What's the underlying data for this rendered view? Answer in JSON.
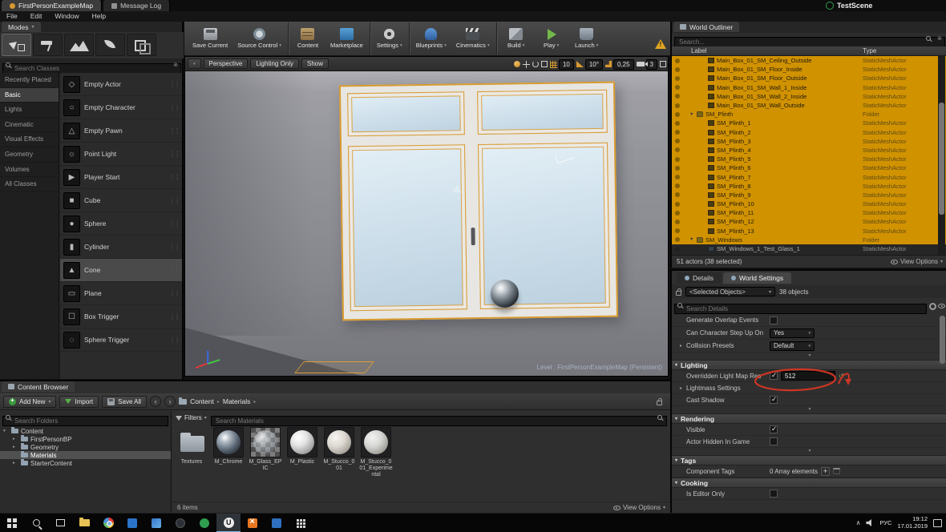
{
  "colors": {
    "selection_orange": "#D19200",
    "annotation_red": "#CC3524",
    "play_green": "#74B84C",
    "sky_blue": "#CCDEEA"
  },
  "titlebar": {
    "tabs": [
      {
        "label": "FirstPersonExampleMap"
      },
      {
        "label": "Message Log"
      }
    ],
    "scene_name": "TestScene"
  },
  "menubar": {
    "items": [
      "File",
      "Edit",
      "Window",
      "Help"
    ]
  },
  "modes": {
    "tab_label": "Modes",
    "tools": [
      {
        "name": "place-mode-icon",
        "cls": "mi-place",
        "active": true
      },
      {
        "name": "paint-mode-icon",
        "cls": "mi-paint",
        "active": false
      },
      {
        "name": "landscape-mode-icon",
        "cls": "mi-landscape",
        "active": false
      },
      {
        "name": "foliage-mode-icon",
        "cls": "mi-foliage",
        "active": false
      },
      {
        "name": "geometry-mode-icon",
        "cls": "mi-geometry",
        "active": false
      }
    ],
    "search_placeholder": "Search Classes",
    "categories": [
      {
        "label": "Recently Placed",
        "active": false
      },
      {
        "label": "Basic",
        "active": true
      },
      {
        "label": "Lights",
        "active": false
      },
      {
        "label": "Cinematic",
        "active": false
      },
      {
        "label": "Visual Effects",
        "active": false
      },
      {
        "label": "Geometry",
        "active": false
      },
      {
        "label": "Volumes",
        "active": false
      },
      {
        "label": "All Classes",
        "active": false
      }
    ],
    "actors": [
      {
        "label": "Empty Actor",
        "glyph": "◇",
        "active": false
      },
      {
        "label": "Empty Character",
        "glyph": "○",
        "active": false
      },
      {
        "label": "Empty Pawn",
        "glyph": "△",
        "active": false
      },
      {
        "label": "Point Light",
        "glyph": "☼",
        "active": false
      },
      {
        "label": "Player Start",
        "glyph": "▶",
        "active": false
      },
      {
        "label": "Cube",
        "glyph": "■",
        "active": false
      },
      {
        "label": "Sphere",
        "glyph": "●",
        "active": false
      },
      {
        "label": "Cylinder",
        "glyph": "▮",
        "active": false
      },
      {
        "label": "Cone",
        "glyph": "▲",
        "active": true
      },
      {
        "label": "Plane",
        "glyph": "▭",
        "active": false
      },
      {
        "label": "Box Trigger",
        "glyph": "☐",
        "active": false
      },
      {
        "label": "Sphere Trigger",
        "glyph": "◌",
        "active": false
      }
    ]
  },
  "toolbar": {
    "buttons": [
      {
        "label": "Save Current",
        "cls": "ic-save",
        "dropdown": false,
        "sep": false
      },
      {
        "label": "Source Control",
        "cls": "ic-sc",
        "dropdown": true,
        "sep": true
      },
      {
        "label": "Content",
        "cls": "ic-content",
        "dropdown": false,
        "sep": false
      },
      {
        "label": "Marketplace",
        "cls": "ic-market",
        "dropdown": false,
        "sep": true
      },
      {
        "label": "Settings",
        "cls": "ic-settings",
        "dropdown": true,
        "sep": true
      },
      {
        "label": "Blueprints",
        "cls": "ic-bp",
        "dropdown": true,
        "sep": false
      },
      {
        "label": "Cinematics",
        "cls": "ic-cine",
        "dropdown": true,
        "sep": true
      },
      {
        "label": "Build",
        "cls": "ic-build",
        "dropdown": true,
        "sep": false
      },
      {
        "label": "Play",
        "cls": "ic-play",
        "dropdown": true,
        "sep": false
      },
      {
        "label": "Launch",
        "cls": "ic-launch",
        "dropdown": true,
        "sep": false
      }
    ]
  },
  "viewport": {
    "camera_mode": "Perspective",
    "view_mode": "Lighting Only",
    "show_label": "Show",
    "grid_snap_value": "10",
    "rotation_snap_value": "10°",
    "scale_snap_value": "0,25",
    "camera_speed_value": "3",
    "level_label": "Level : FirstPersonExampleMap (Persistent)"
  },
  "outliner": {
    "tab_label": "World Outliner",
    "search_placeholder": "Search...",
    "columns": [
      "Label",
      "Type"
    ],
    "rows": [
      {
        "label": "Main_Box_01_SM_Ceiling_Outside",
        "type": "StaticMeshActor",
        "exp": "",
        "icon": "mesh",
        "ind": "i2",
        "sel": true
      },
      {
        "label": "Main_Box_01_SM_Floor_Inside",
        "type": "StaticMeshActor",
        "exp": "",
        "icon": "mesh",
        "ind": "i2",
        "sel": true
      },
      {
        "label": "Main_Box_01_SM_Floor_Outside",
        "type": "StaticMeshActor",
        "exp": "",
        "icon": "mesh",
        "ind": "i2",
        "sel": true
      },
      {
        "label": "Main_Box_01_SM_Wall_1_Inside",
        "type": "StaticMeshActor",
        "exp": "",
        "icon": "mesh",
        "ind": "i2",
        "sel": true
      },
      {
        "label": "Main_Box_01_SM_Wall_2_Inside",
        "type": "StaticMeshActor",
        "exp": "",
        "icon": "mesh",
        "ind": "i2",
        "sel": true
      },
      {
        "label": "Main_Box_01_SM_Wall_Outside",
        "type": "StaticMeshActor",
        "exp": "",
        "icon": "mesh",
        "ind": "i2",
        "sel": true
      },
      {
        "label": "SM_Plinth",
        "type": "Folder",
        "exp": "▼",
        "icon": "folder",
        "ind": "i1",
        "sel": true
      },
      {
        "label": "SM_Plinth_1",
        "type": "StaticMeshActor",
        "exp": "",
        "icon": "mesh",
        "ind": "i2",
        "sel": true
      },
      {
        "label": "SM_Plinth_2",
        "type": "StaticMeshActor",
        "exp": "",
        "icon": "mesh",
        "ind": "i2",
        "sel": true
      },
      {
        "label": "SM_Plinth_3",
        "type": "StaticMeshActor",
        "exp": "",
        "icon": "mesh",
        "ind": "i2",
        "sel": true
      },
      {
        "label": "SM_Plinth_4",
        "type": "StaticMeshActor",
        "exp": "",
        "icon": "mesh",
        "ind": "i2",
        "sel": true
      },
      {
        "label": "SM_Plinth_5",
        "type": "StaticMeshActor",
        "exp": "",
        "icon": "mesh",
        "ind": "i2",
        "sel": true
      },
      {
        "label": "SM_Plinth_6",
        "type": "StaticMeshActor",
        "exp": "",
        "icon": "mesh",
        "ind": "i2",
        "sel": true
      },
      {
        "label": "SM_Plinth_7",
        "type": "StaticMeshActor",
        "exp": "",
        "icon": "mesh",
        "ind": "i2",
        "sel": true
      },
      {
        "label": "SM_Plinth_8",
        "type": "StaticMeshActor",
        "exp": "",
        "icon": "mesh",
        "ind": "i2",
        "sel": true
      },
      {
        "label": "SM_Plinth_9",
        "type": "StaticMeshActor",
        "exp": "",
        "icon": "mesh",
        "ind": "i2",
        "sel": true
      },
      {
        "label": "SM_Plinth_10",
        "type": "StaticMeshActor",
        "exp": "",
        "icon": "mesh",
        "ind": "i2",
        "sel": true
      },
      {
        "label": "SM_Plinth_11",
        "type": "StaticMeshActor",
        "exp": "",
        "icon": "mesh",
        "ind": "i2",
        "sel": true
      },
      {
        "label": "SM_Plinth_12",
        "type": "StaticMeshActor",
        "exp": "",
        "icon": "mesh",
        "ind": "i2",
        "sel": true
      },
      {
        "label": "SM_Plinth_13",
        "type": "StaticMeshActor",
        "exp": "",
        "icon": "mesh",
        "ind": "i2",
        "sel": true
      },
      {
        "label": "SM_Windows",
        "type": "Folder",
        "exp": "▼",
        "icon": "folder",
        "ind": "i1",
        "sel": true
      },
      {
        "label": "SM_Windows_1_Test_Glass_1",
        "type": "StaticMeshActor",
        "exp": "",
        "icon": "mesh",
        "ind": "i2",
        "sel": false
      }
    ],
    "footer": "51 actors (38 selected)",
    "view_options_label": "View Options"
  },
  "details": {
    "tab_details": "Details",
    "tab_world_settings": "World Settings",
    "selected_objects": "<Selected Objects>",
    "objects_count": "38 objects",
    "search_placeholder": "Search Details",
    "top_rows": [
      {
        "label": "Generate Overlap Events",
        "exp": "",
        "chk": "cb un"
      },
      {
        "label": "Can Character Step Up On",
        "exp": "",
        "dd": "Yes"
      },
      {
        "label": "Collision Presets",
        "exp": "▸",
        "dd": "Default"
      }
    ],
    "lighting": {
      "title": "Lighting",
      "rows": [
        {
          "label": "Overridden Light Map Res",
          "exp": "",
          "chk": "cb on",
          "input": "512",
          "reset": "↺"
        },
        {
          "label": "Lightmass Settings",
          "exp": "▸"
        },
        {
          "label": "Cast Shadow",
          "exp": "",
          "chk": "cb on"
        }
      ]
    },
    "rendering": {
      "title": "Rendering",
      "rows": [
        {
          "label": "Visible",
          "exp": "",
          "chk": "cb on"
        },
        {
          "label": "Actor Hidden In Game",
          "exp": "",
          "chk": "cb un"
        }
      ]
    },
    "tags": {
      "title": "Tags",
      "rows": [
        {
          "label": "Component Tags",
          "exp": "",
          "text": "0 Array elements",
          "icons": true
        }
      ]
    },
    "cooking": {
      "title": "Cooking",
      "rows": [
        {
          "label": "Is Editor Only",
          "exp": "",
          "chk": "cb un"
        }
      ]
    }
  },
  "content_browser": {
    "tab_label": "Content Browser",
    "add_new_label": "Add New",
    "import_label": "Import",
    "save_all_label": "Save All",
    "breadcrumb": [
      {
        "label": "Content"
      },
      {
        "label": "Materials"
      }
    ],
    "search_folders_placeholder": "Search Folders",
    "tree": [
      {
        "label": "Content",
        "exp": "▾",
        "child": false,
        "selected": false
      },
      {
        "label": "FirstPersonBP",
        "exp": "▸",
        "child": true,
        "selected": false
      },
      {
        "label": "Geometry",
        "exp": "▸",
        "child": true,
        "selected": false
      },
      {
        "label": "Materials",
        "exp": "",
        "child": true,
        "selected": true
      },
      {
        "label": "StarterContent",
        "exp": "▸",
        "child": true,
        "selected": false
      }
    ],
    "filters_label": "Filters",
    "search_assets_placeholder": "Search Materials",
    "assets": [
      {
        "label": "Textures",
        "cls": "th-folder"
      },
      {
        "label": "M_Chrome",
        "cls": "th-chrome"
      },
      {
        "label": "M_Glass_EPIC",
        "cls": "th-glass"
      },
      {
        "label": "M_Plastic",
        "cls": "th-plastic"
      },
      {
        "label": "M_Stucco_001",
        "cls": "th-stucco"
      },
      {
        "label": "M_Stucco_001_Experimental",
        "cls": "th-stucco2"
      }
    ],
    "items_count": "6 items",
    "view_options_label": "View Options"
  },
  "taskbar": {
    "icons": [
      {
        "name": "start-button",
        "cls": "tb-start",
        "active": false
      },
      {
        "name": "search-icon",
        "cls": "tb-search",
        "active": false
      },
      {
        "name": "task-view-icon",
        "cls": "tb-taskview",
        "active": false
      },
      {
        "name": "file-explorer-icon",
        "cls": "tb-folder",
        "active": false
      },
      {
        "name": "browser-icon",
        "cls": "tb-browser",
        "active": false
      },
      {
        "name": "store-icon",
        "cls": "tb-store",
        "active": false
      },
      {
        "name": "photos-icon",
        "cls": "tb-photos",
        "active": false
      },
      {
        "name": "app-icon-dark",
        "cls": "tb-dark",
        "active": false
      },
      {
        "name": "app-icon-green",
        "cls": "tb-green",
        "active": false
      },
      {
        "name": "unreal-engine-icon",
        "cls": "tb-unreal",
        "active": true
      },
      {
        "name": "app-icon-orange",
        "cls": "tb-orange",
        "active": false
      },
      {
        "name": "app-icon-blue",
        "cls": "tb-blue",
        "active": false
      },
      {
        "name": "calculator-icon",
        "cls": "tb-grid",
        "active": false
      }
    ],
    "lang": "РУС",
    "time": "19:12",
    "date": "17.01.2019"
  }
}
